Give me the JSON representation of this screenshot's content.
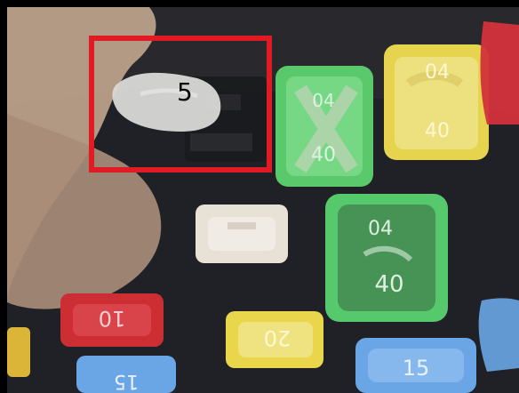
{
  "photo": {
    "highlight_label": "5",
    "colors": {
      "frame": "#000000",
      "highlight": "#e01b24",
      "fuse_green": "#5fcf73",
      "fuse_yellow": "#e8d55a",
      "fuse_red": "#d0322f",
      "fuse_blue": "#6aa6e6",
      "fuse_white": "#e6e0d7"
    },
    "visible_fuse_markings": [
      "04",
      "40",
      "04",
      "40",
      "04",
      "40",
      "10",
      "20",
      "15",
      "15"
    ]
  }
}
